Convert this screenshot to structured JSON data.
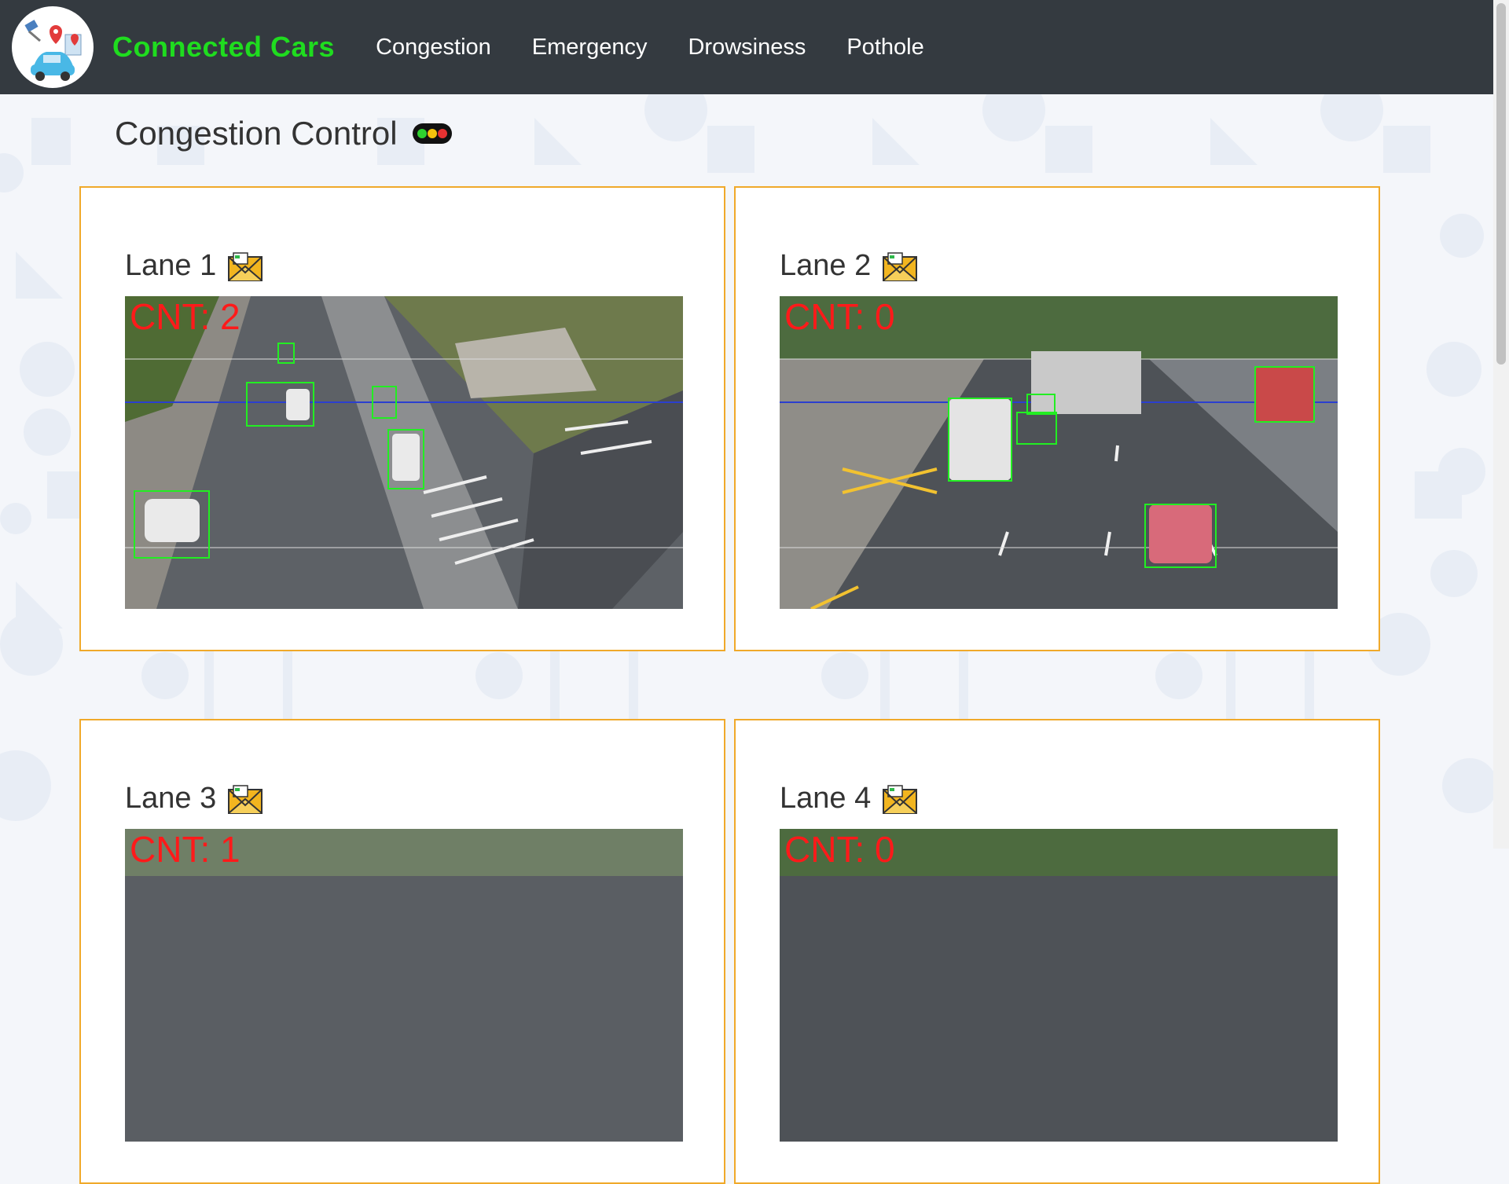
{
  "brand": "Connected Cars",
  "nav": [
    {
      "label": "Congestion"
    },
    {
      "label": "Emergency"
    },
    {
      "label": "Drowsiness"
    },
    {
      "label": "Pothole"
    }
  ],
  "page_title": "Congestion Control",
  "lanes": [
    {
      "title": "Lane 1",
      "count": "CNT: 2"
    },
    {
      "title": "Lane 2",
      "count": "CNT: 0"
    },
    {
      "title": "Lane 3",
      "count": "CNT: 1"
    },
    {
      "title": "Lane 4",
      "count": "CNT: 0"
    }
  ],
  "colors": {
    "navbar": "#343a40",
    "brand": "#1fdc1f",
    "card_border": "#f0a92a",
    "count_text": "#ff1a1a",
    "detection_box": "#22ee22"
  },
  "icons": [
    "traffic-light-icon",
    "envelope-icon",
    "car-logo-icon"
  ]
}
